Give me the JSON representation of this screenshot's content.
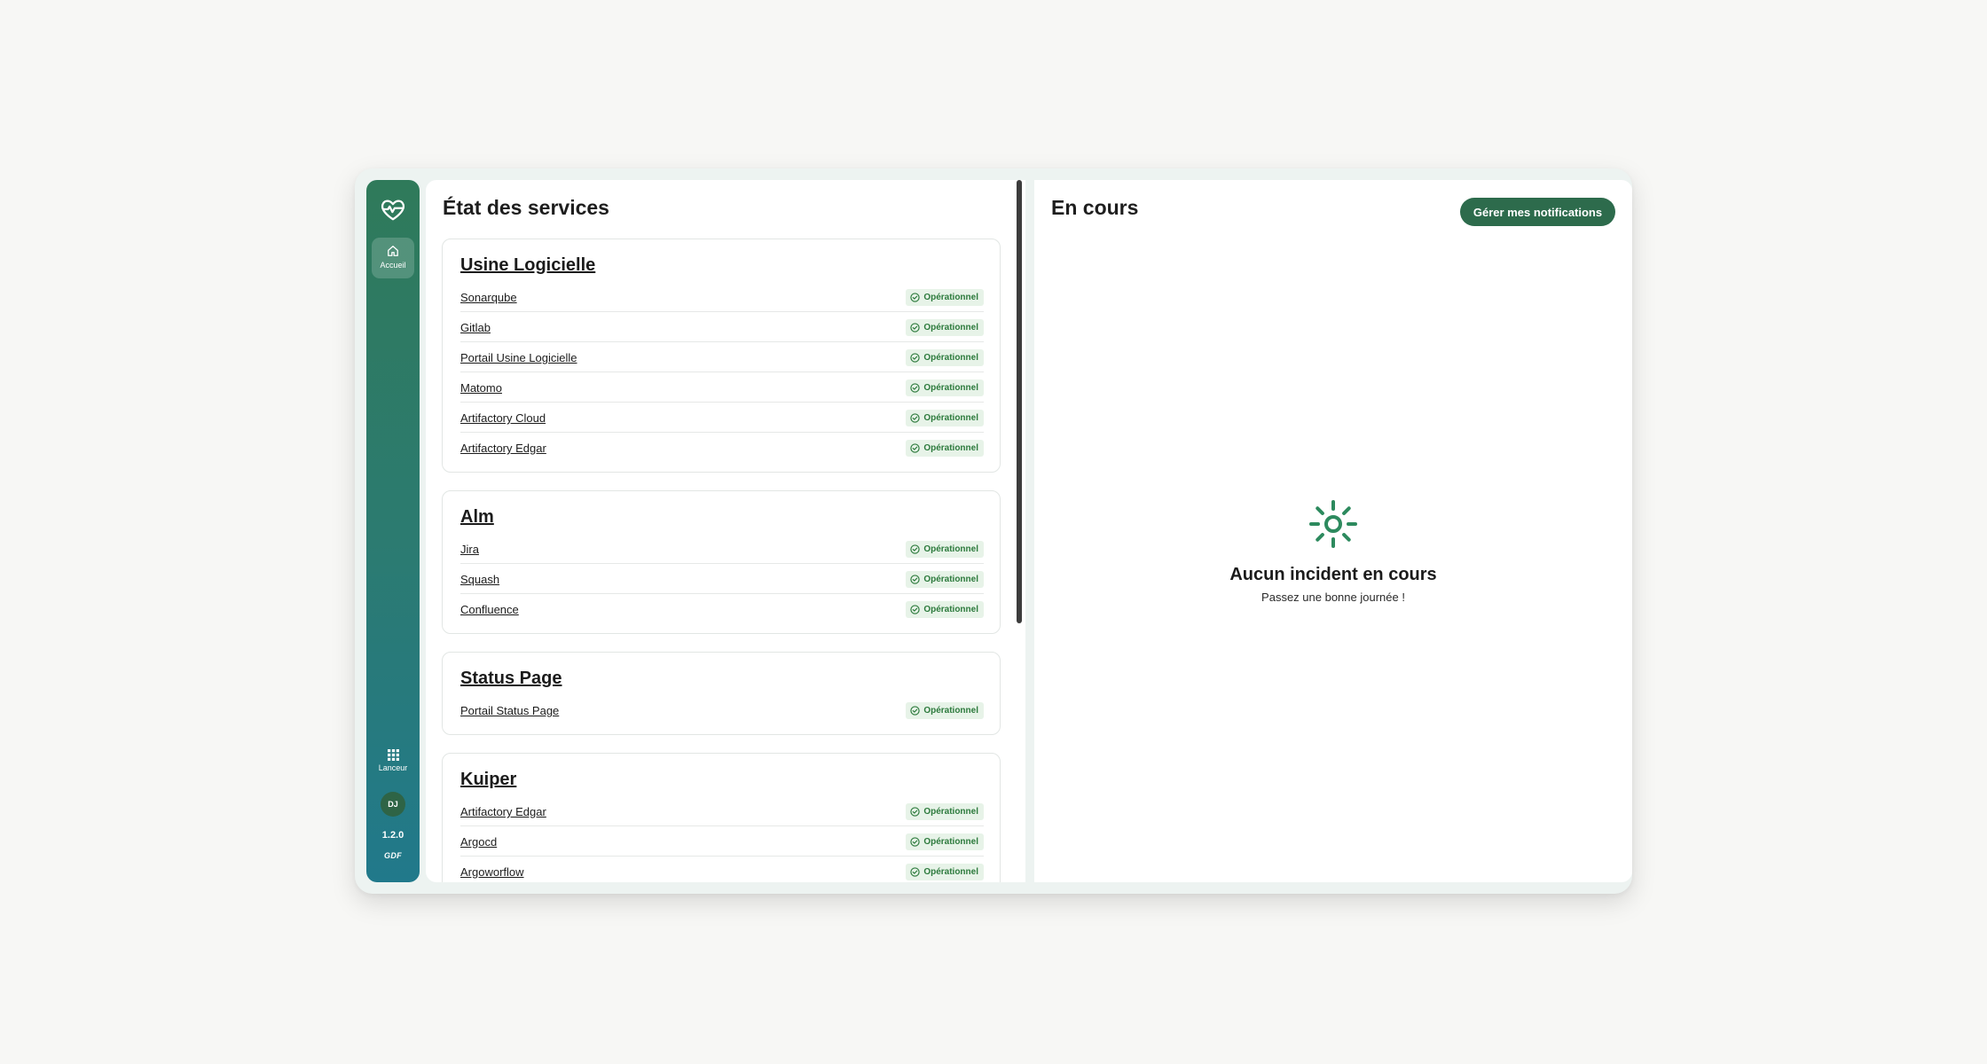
{
  "sidebar": {
    "home_label": "Accueil",
    "launcher_label": "Lanceur",
    "avatar_initials": "DJ",
    "version": "1.2.0",
    "brand": "GDF"
  },
  "status": {
    "title": "État des services",
    "groups": [
      {
        "name": "Usine Logicielle",
        "services": [
          {
            "name": "Sonarqube",
            "status": "Opérationnel"
          },
          {
            "name": "Gitlab",
            "status": "Opérationnel"
          },
          {
            "name": "Portail Usine Logicielle",
            "status": "Opérationnel"
          },
          {
            "name": "Matomo",
            "status": "Opérationnel"
          },
          {
            "name": "Artifactory Cloud",
            "status": "Opérationnel"
          },
          {
            "name": "Artifactory Edgar",
            "status": "Opérationnel"
          }
        ]
      },
      {
        "name": "Alm",
        "services": [
          {
            "name": "Jira",
            "status": "Opérationnel"
          },
          {
            "name": "Squash",
            "status": "Opérationnel"
          },
          {
            "name": "Confluence",
            "status": "Opérationnel"
          }
        ]
      },
      {
        "name": "Status Page",
        "services": [
          {
            "name": "Portail Status Page",
            "status": "Opérationnel"
          }
        ]
      },
      {
        "name": "Kuiper",
        "services": [
          {
            "name": "Artifactory Edgar",
            "status": "Opérationnel"
          },
          {
            "name": "Argocd",
            "status": "Opérationnel"
          },
          {
            "name": "Argoworflow",
            "status": "Opérationnel"
          }
        ]
      }
    ]
  },
  "incidents": {
    "title": "En cours",
    "notifications_button": "Gérer mes notifications",
    "empty_title": "Aucun incident en cours",
    "empty_subtitle": "Passez une bonne journée !"
  },
  "colors": {
    "accent": "#2d6b4c",
    "status_ok": "#2c7a3c",
    "status_ok_bg": "#e7f3e8"
  }
}
